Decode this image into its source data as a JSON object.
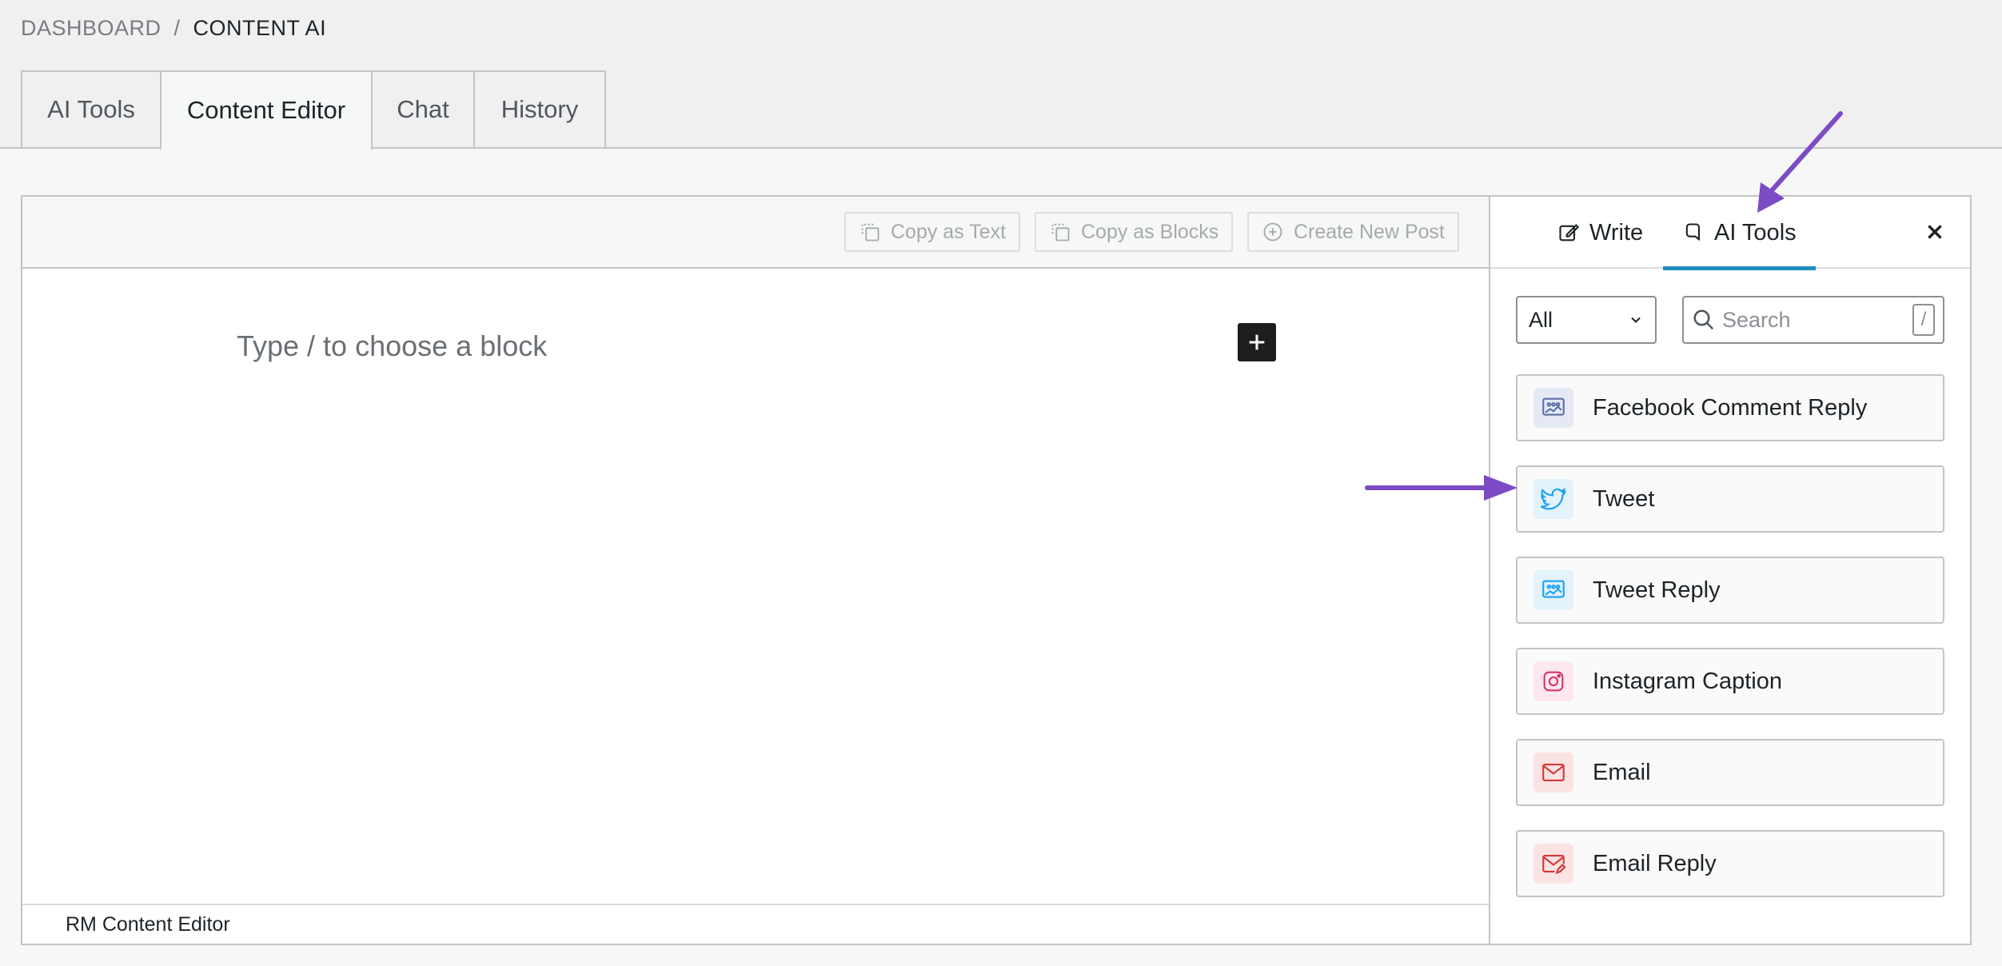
{
  "breadcrumb": {
    "parent": "DASHBOARD",
    "separator": "/",
    "current": "CONTENT AI"
  },
  "tabs": [
    {
      "label": "AI Tools"
    },
    {
      "label": "Content Editor"
    },
    {
      "label": "Chat"
    },
    {
      "label": "History"
    }
  ],
  "toolbar": {
    "copy_text": "Copy as Text",
    "copy_blocks": "Copy as Blocks",
    "create_post": "Create New Post"
  },
  "editor": {
    "placeholder": "Type / to choose a block",
    "footer": "RM Content Editor"
  },
  "sidebar": {
    "write_tab": "Write",
    "ai_tools_tab": "AI Tools",
    "filter_value": "All",
    "search_placeholder": "Search",
    "search_shortcut": "/",
    "tools": [
      {
        "label": "Facebook Comment Reply",
        "icon": "chat-image-icon",
        "color": "#5b6fa8",
        "bg": "#e5e9f5"
      },
      {
        "label": "Tweet",
        "icon": "twitter-bird-icon",
        "color": "#1da1f2",
        "bg": "#e3f2fb"
      },
      {
        "label": "Tweet Reply",
        "icon": "chat-image-icon",
        "color": "#1da1f2",
        "bg": "#e3f2fb"
      },
      {
        "label": "Instagram Caption",
        "icon": "instagram-icon",
        "color": "#d6336c",
        "bg": "#fde8ef"
      },
      {
        "label": "Email",
        "icon": "envelope-icon",
        "color": "#d63638",
        "bg": "#fbe3e3"
      },
      {
        "label": "Email Reply",
        "icon": "envelope-edit-icon",
        "color": "#d63638",
        "bg": "#fbe3e3"
      }
    ]
  },
  "colors": {
    "accent": "#1e8cbe",
    "annotation_arrow": "#7b4bc4"
  }
}
